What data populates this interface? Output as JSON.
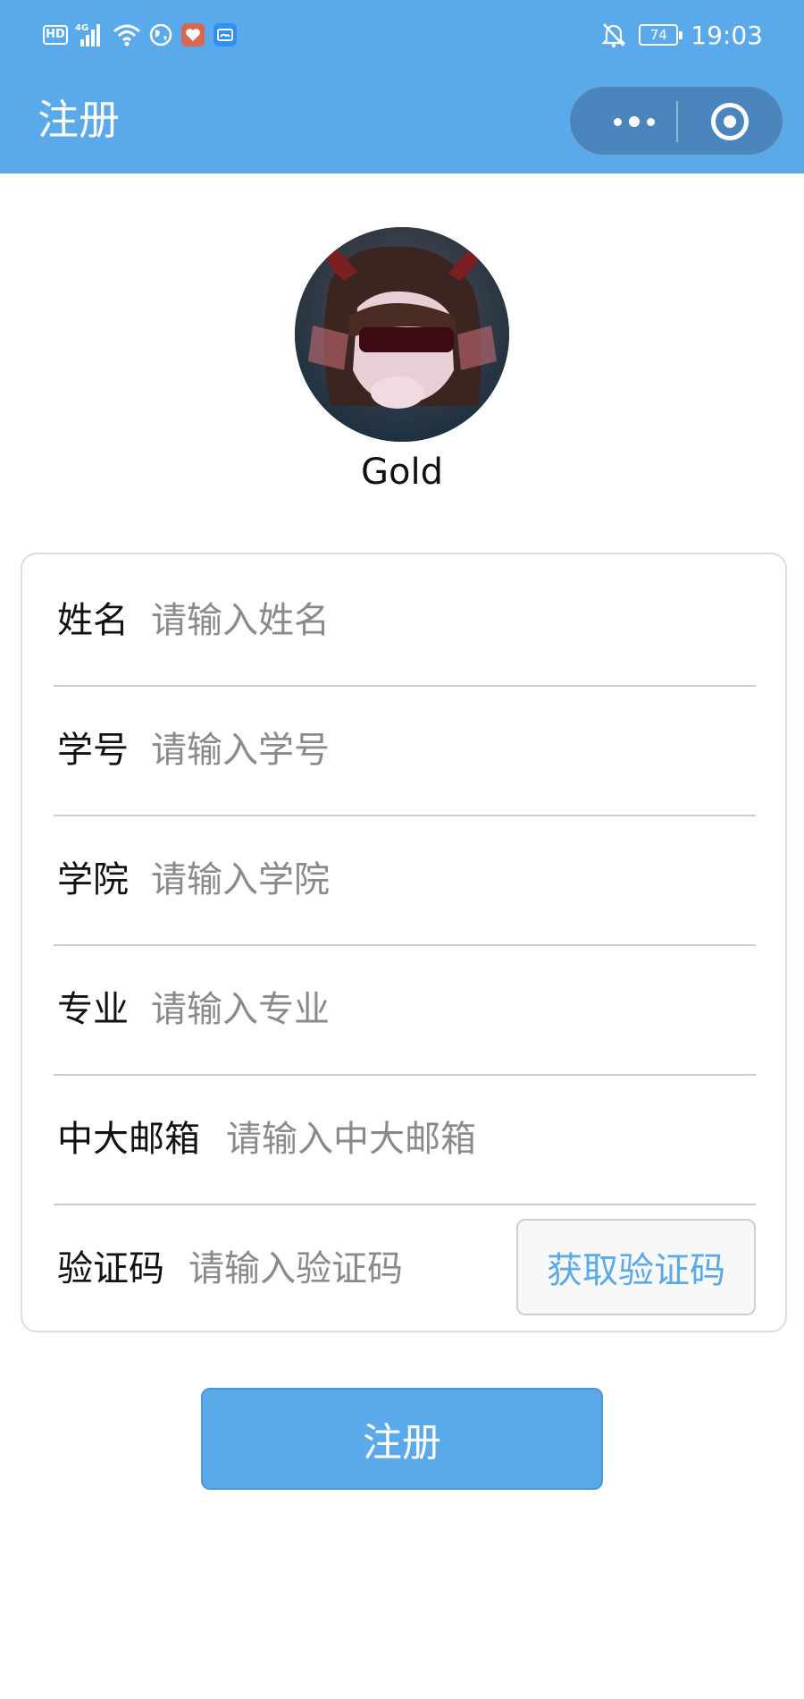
{
  "status_bar": {
    "left_icons": [
      "hd-icon",
      "signal-4g-icon",
      "wifi-icon",
      "globe-icon",
      "health-app-icon",
      "weather-app-icon"
    ],
    "hd_label": "HD",
    "network_label": "4G",
    "battery_level": "74",
    "time": "19:03",
    "right_icons": [
      "notifications-off-icon",
      "battery-icon"
    ]
  },
  "header": {
    "title": "注册",
    "background_color": "#5aa9ea",
    "capsule_icons": [
      "more-icon",
      "close-target-icon"
    ]
  },
  "profile": {
    "username": "Gold"
  },
  "form": {
    "fields": [
      {
        "label": "姓名",
        "placeholder": "请输入姓名"
      },
      {
        "label": "学号",
        "placeholder": "请输入学号"
      },
      {
        "label": "学院",
        "placeholder": "请输入学院"
      },
      {
        "label": "专业",
        "placeholder": "请输入专业"
      },
      {
        "label": "中大邮箱",
        "placeholder": "请输入中大邮箱"
      },
      {
        "label": "验证码",
        "placeholder": "请输入验证码"
      }
    ],
    "get_code_label": "获取验证码"
  },
  "submit_label": "注册",
  "colors": {
    "accent": "#5aa9ea",
    "border": "#dcdcdc",
    "placeholder": "#8a8a8a"
  }
}
